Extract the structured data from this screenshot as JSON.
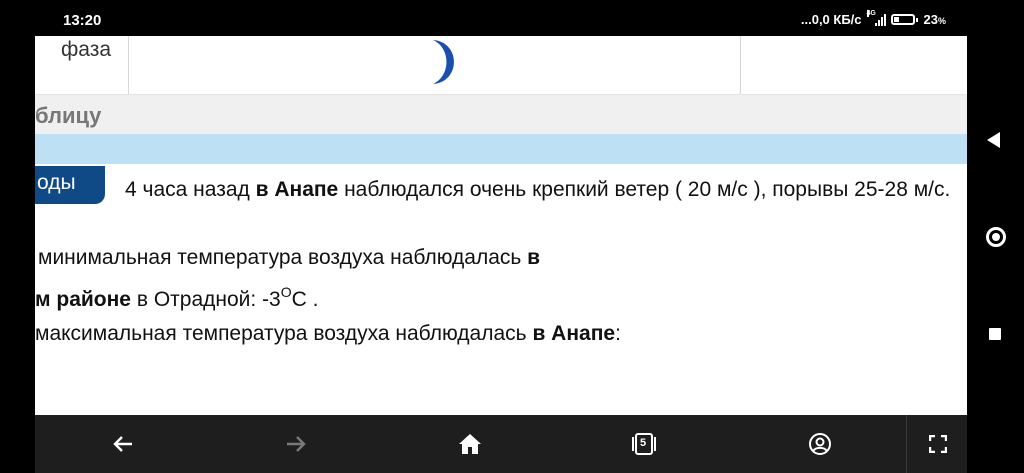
{
  "status_bar": {
    "time": "13:20",
    "network_speed": "...0,0 КБ/с",
    "signal_type": "4G",
    "battery_percent": "23",
    "battery_sign": "%"
  },
  "page": {
    "phase_label": "фаза",
    "table_link": "блицу",
    "tab_label": "оды",
    "news_time": "4 часа назад",
    "news_location": "в Анапе",
    "news_text": "наблюдался очень крепкий ветер ( 20 м/с ), порывы 25-28 м/с.",
    "min_temp_text": "минимальная температура воздуха наблюдалась",
    "min_temp_loc_in": "в",
    "min_temp_district": "м районе",
    "min_temp_place": "в Отрадной: -3",
    "min_temp_deg": "О",
    "min_temp_unit": "С .",
    "max_temp_text": "максимальная температура воздуха наблюдалась",
    "max_temp_loc": "в Анапе",
    "max_temp_colon": ":"
  },
  "toolbar": {
    "tabs_count": "5"
  },
  "colors": {
    "tab_blue": "#0f4a87",
    "band_blue": "#bee0f5",
    "moon": "#1a4fb0",
    "toolbar_bg": "#1e1e1e"
  }
}
